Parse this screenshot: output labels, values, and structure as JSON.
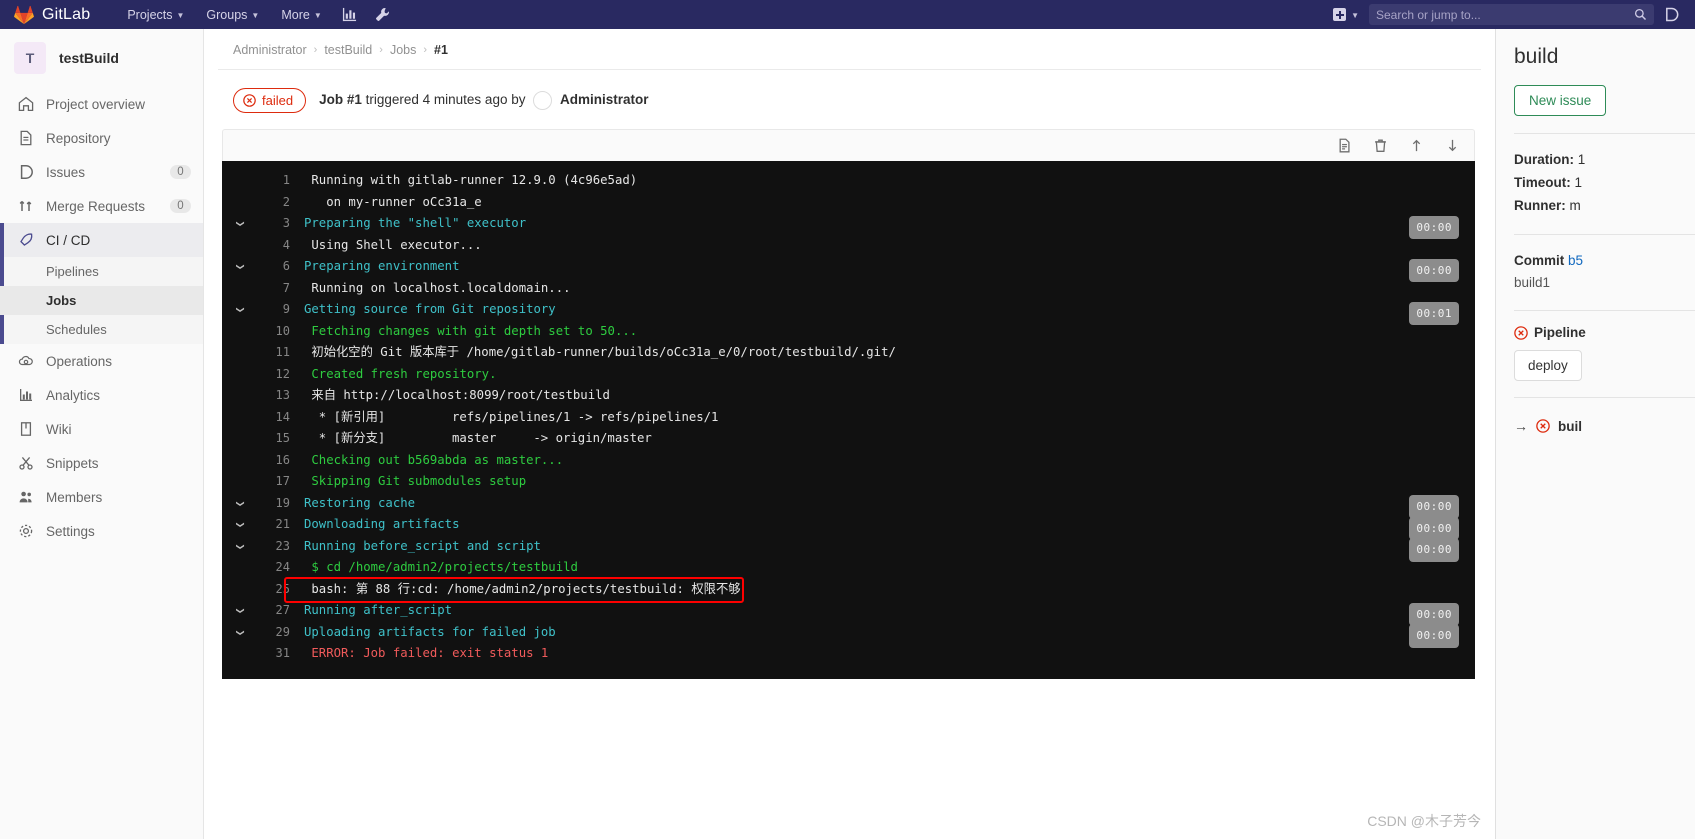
{
  "topnav": {
    "brand": "GitLab",
    "links": [
      {
        "label": "Projects",
        "icon": "chevron-down-icon"
      },
      {
        "label": "Groups",
        "icon": "chevron-down-icon"
      },
      {
        "label": "More",
        "icon": "chevron-down-icon"
      }
    ],
    "icons": [
      "analytics-icon",
      "wrench-icon"
    ],
    "plus_icon": "plus-square-icon",
    "plus_caret": "chevron-down-icon",
    "search_placeholder": "Search or jump to...",
    "search_value": "",
    "search_icon": "search-icon",
    "issues_icon": "issues-icon"
  },
  "sidebar": {
    "project_initial": "T",
    "project_name": "testBuild",
    "items": [
      {
        "label": "Project overview",
        "icon": "home-icon",
        "badge": ""
      },
      {
        "label": "Repository",
        "icon": "document-icon",
        "badge": ""
      },
      {
        "label": "Issues",
        "icon": "issues-icon",
        "badge": "0"
      },
      {
        "label": "Merge Requests",
        "icon": "merge-icon",
        "badge": "0"
      },
      {
        "label": "CI / CD",
        "icon": "rocket-icon",
        "badge": "",
        "active": true
      },
      {
        "label": "Operations",
        "icon": "cloud-gear-icon",
        "badge": ""
      },
      {
        "label": "Analytics",
        "icon": "chart-icon",
        "badge": ""
      },
      {
        "label": "Wiki",
        "icon": "book-icon",
        "badge": ""
      },
      {
        "label": "Snippets",
        "icon": "scissors-icon",
        "badge": ""
      },
      {
        "label": "Members",
        "icon": "people-icon",
        "badge": ""
      },
      {
        "label": "Settings",
        "icon": "gear-icon",
        "badge": ""
      }
    ],
    "subitems": [
      {
        "label": "Pipelines",
        "selected": false
      },
      {
        "label": "Jobs",
        "selected": true
      },
      {
        "label": "Schedules",
        "selected": false
      }
    ]
  },
  "breadcrumb": {
    "items": [
      "Administrator",
      "testBuild",
      "Jobs"
    ],
    "current": "#1",
    "separator": "›"
  },
  "job": {
    "status_label": "failed",
    "status_icon": "failed-icon",
    "title_bold": "Job #1",
    "title_rest": "triggered 4 minutes ago by",
    "author": "Administrator",
    "status_color": "#dd2b0e"
  },
  "log_toolbar": {
    "buttons": [
      {
        "name": "raw-log-icon",
        "title": "Show complete raw"
      },
      {
        "name": "trash-icon",
        "title": "Erase job log"
      },
      {
        "name": "scroll-top-icon",
        "title": "Scroll to top"
      },
      {
        "name": "scroll-bottom-icon",
        "title": "Scroll to bottom"
      }
    ]
  },
  "log": {
    "lines": [
      {
        "num": "1",
        "text": "Running with gitlab-runner 12.9.0 (4c96e5ad)",
        "color": "white",
        "indent": 1,
        "arrow": false,
        "time": ""
      },
      {
        "num": "2",
        "text": "  on my-runner oCc31a_e",
        "color": "white",
        "indent": 1,
        "arrow": false,
        "time": ""
      },
      {
        "num": "3",
        "text": "Preparing the \"shell\" executor",
        "color": "cyan",
        "indent": 0,
        "arrow": true,
        "time": "00:00"
      },
      {
        "num": "4",
        "text": "Using Shell executor...",
        "color": "white",
        "indent": 1,
        "arrow": false,
        "time": ""
      },
      {
        "num": "6",
        "text": "Preparing environment",
        "color": "cyan",
        "indent": 0,
        "arrow": true,
        "time": "00:00"
      },
      {
        "num": "7",
        "text": "Running on localhost.localdomain...",
        "color": "white",
        "indent": 1,
        "arrow": false,
        "time": ""
      },
      {
        "num": "9",
        "text": "Getting source from Git repository",
        "color": "cyan",
        "indent": 0,
        "arrow": true,
        "time": "00:01"
      },
      {
        "num": "10",
        "text": "Fetching changes with git depth set to 50...",
        "color": "green",
        "indent": 1,
        "arrow": false,
        "time": ""
      },
      {
        "num": "11",
        "text": "初始化空的 Git 版本库于 /home/gitlab-runner/builds/oCc31a_e/0/root/testbuild/.git/",
        "color": "white",
        "indent": 1,
        "arrow": false,
        "time": ""
      },
      {
        "num": "12",
        "text": "Created fresh repository.",
        "color": "green",
        "indent": 1,
        "arrow": false,
        "time": ""
      },
      {
        "num": "13",
        "text": "来自 http://localhost:8099/root/testbuild",
        "color": "white",
        "indent": 1,
        "arrow": false,
        "time": ""
      },
      {
        "num": "14",
        "text": " * [新引用]         refs/pipelines/1 -> refs/pipelines/1",
        "color": "white",
        "indent": 1,
        "arrow": false,
        "time": ""
      },
      {
        "num": "15",
        "text": " * [新分支]         master     -> origin/master",
        "color": "white",
        "indent": 1,
        "arrow": false,
        "time": ""
      },
      {
        "num": "16",
        "text": "Checking out b569abda as master...",
        "color": "green",
        "indent": 1,
        "arrow": false,
        "time": ""
      },
      {
        "num": "17",
        "text": "Skipping Git submodules setup",
        "color": "green",
        "indent": 1,
        "arrow": false,
        "time": ""
      },
      {
        "num": "19",
        "text": "Restoring cache",
        "color": "cyan",
        "indent": 0,
        "arrow": true,
        "time": "00:00"
      },
      {
        "num": "21",
        "text": "Downloading artifacts",
        "color": "cyan",
        "indent": 0,
        "arrow": true,
        "time": "00:00"
      },
      {
        "num": "23",
        "text": "Running before_script and script",
        "color": "cyan",
        "indent": 0,
        "arrow": true,
        "time": "00:00"
      },
      {
        "num": "24",
        "text": "$ cd /home/admin2/projects/testbuild",
        "color": "green",
        "indent": 1,
        "arrow": false,
        "time": ""
      },
      {
        "num": "25",
        "text": "bash: 第 88 行:cd: /home/admin2/projects/testbuild: 权限不够",
        "color": "white",
        "indent": 1,
        "arrow": false,
        "time": "",
        "highlight": true
      },
      {
        "num": "27",
        "text": "Running after_script",
        "color": "cyan",
        "indent": 0,
        "arrow": true,
        "time": "00:00"
      },
      {
        "num": "29",
        "text": "Uploading artifacts for failed job",
        "color": "cyan",
        "indent": 0,
        "arrow": true,
        "time": "00:00"
      },
      {
        "num": "31",
        "text": "ERROR: Job failed: exit status 1",
        "color": "red",
        "indent": 1,
        "arrow": false,
        "time": ""
      }
    ],
    "highlight_color": "#fe0000"
  },
  "rightpanel": {
    "title": "build",
    "new_issue_label": "New issue",
    "duration_label": "Duration:",
    "duration_value": "1",
    "timeout_label": "Timeout:",
    "timeout_value": "1",
    "runner_label": "Runner:",
    "runner_value": "m",
    "commit_label": "Commit",
    "commit_sha": "b5",
    "commit_msg": "build1",
    "pipeline_label": "Pipeline",
    "pipeline_icon": "failed-icon",
    "stage_label": "deploy",
    "job_arrow": "→",
    "job_name": "buil",
    "job_icon": "failed-icon"
  },
  "watermark": "CSDN @木子芳今"
}
